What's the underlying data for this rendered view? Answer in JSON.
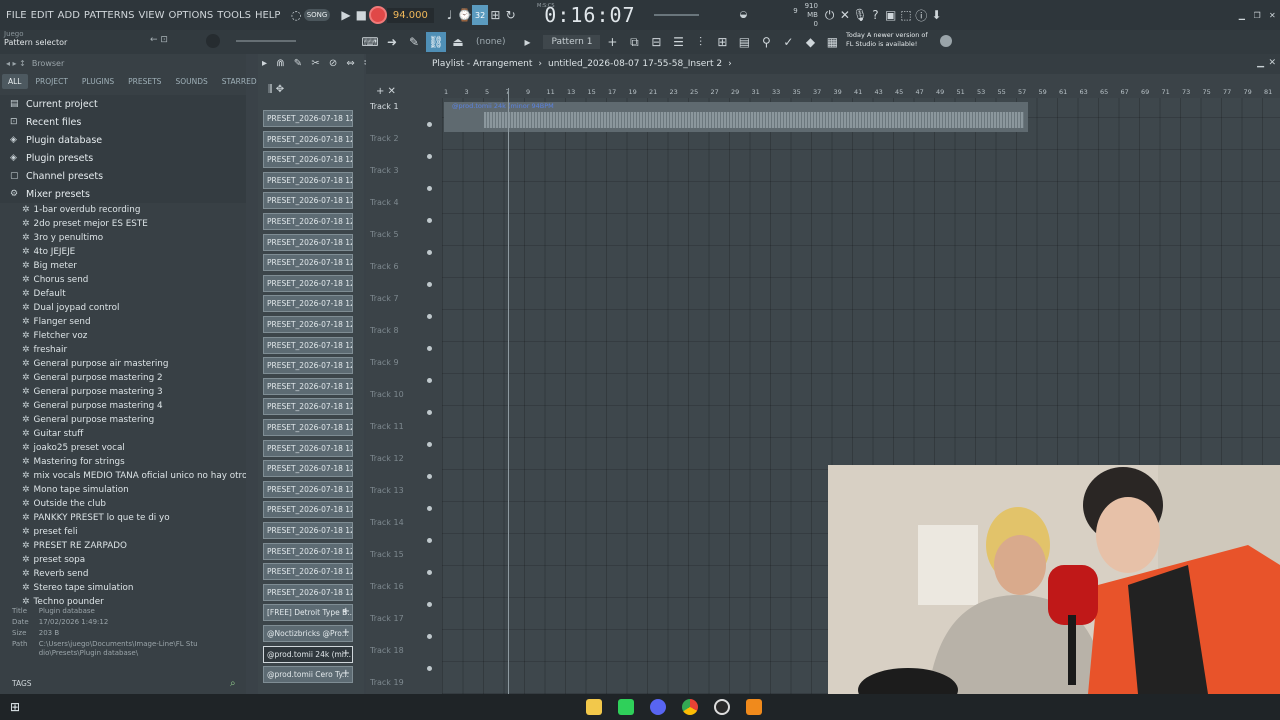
{
  "menu": [
    "FILE",
    "EDIT",
    "ADD",
    "PATTERNS",
    "VIEW",
    "OPTIONS",
    "TOOLS",
    "HELP"
  ],
  "transport": {
    "song_toggle": "SONG",
    "tempo": "94.000",
    "time": "0:16:07",
    "time_mode": "M:S:CS",
    "memory": "910 MB",
    "cpu": "0",
    "bars": "9",
    "beat_snap": "32"
  },
  "toolbar2": {
    "hint_user": "Juego",
    "hint": "Pattern selector",
    "snap": "(none)",
    "pattern": "Pattern 1",
    "news_line1": "Today  A newer version of",
    "news_line2": "FL Studio is available!"
  },
  "browser": {
    "title": "Browser",
    "tabs": [
      "ALL",
      "PROJECT",
      "PLUGINS",
      "PRESETS",
      "SOUNDS",
      "STARRED"
    ],
    "folders": [
      {
        "label": "Current project",
        "icon": "project-icon"
      },
      {
        "label": "Recent files",
        "icon": "recent-icon"
      },
      {
        "label": "Plugin database",
        "icon": "plugin-db-icon"
      },
      {
        "label": "Plugin presets",
        "icon": "plugin-presets-icon"
      },
      {
        "label": "Channel presets",
        "icon": "channel-presets-icon"
      },
      {
        "label": "Mixer presets",
        "icon": "mixer-presets-icon"
      }
    ],
    "presets": [
      "1-bar overdub recording",
      "2do preset mejor ES ESTE",
      "3ro y penultimo",
      "4to JEJEJE",
      "Big meter",
      "Chorus send",
      "Default",
      "Dual joypad control",
      "Flanger send",
      "Fletcher voz",
      "freshair",
      "General purpose air mastering",
      "General purpose mastering 2",
      "General purpose mastering 3",
      "General purpose mastering 4",
      "General purpose mastering",
      "Guitar stuff",
      "joako25 preset vocal",
      "Mastering for strings",
      "mix vocals MEDIO TANA oficial unico no hay otro en el mundo",
      "Mono tape simulation",
      "Outside the club",
      "PANKKY PRESET lo que te di yo",
      "preset feli",
      "PRESET RE ZARPADO",
      "preset sopa",
      "Reverb send",
      "Stereo tape simulation",
      "Techno pounder"
    ],
    "info": {
      "title_k": "Title",
      "title_v": "Plugin database",
      "date_k": "Date",
      "date_v": "17/02/2026 1:49:12",
      "size_k": "Size",
      "size_v": "203 B",
      "path_k": "Path",
      "path_v": "C:\\Users\\juego\\Documents\\Image-Line\\FL Studio\\Presets\\Plugin database\\"
    },
    "tags": "TAGS"
  },
  "samples": [
    "PRESET_2026-07-18 12-...",
    "PRESET_2026-07-18 12-...",
    "PRESET_2026-07-18 12-...",
    "PRESET_2026-07-18 12-...",
    "PRESET_2026-07-18 12-...",
    "PRESET_2026-07-18 12-...",
    "PRESET_2026-07-18 12-...",
    "PRESET_2026-07-18 12-...",
    "PRESET_2026-07-18 12-...",
    "PRESET_2026-07-18 12-...",
    "PRESET_2026-07-18 12-...",
    "PRESET_2026-07-18 12-...",
    "PRESET_2026-07-18 12-...",
    "PRESET_2026-07-18 12-...",
    "PRESET_2026-07-18 12-...",
    "PRESET_2026-07-18 12-...",
    "PRESET_2026-07-18 12-...",
    "PRESET_2026-07-18 12-...",
    "PRESET_2026-07-18 12-...",
    "PRESET_2026-07-18 12-...",
    "PRESET_2026-07-18 12-...",
    "PRESET_2026-07-18 12-...",
    "PRESET_2026-07-18 12-...",
    "PRESET_2026-07-18 12-...",
    "[FREE] Detroit Type B...",
    "@Noctizbricks @Pro...",
    "@prod.tomii 24k (mi...",
    "@prod.tomii Cero Ty..."
  ],
  "playlist": {
    "title": "Playlist - Arrangement",
    "project": "untitled_2026-08-07 17-55-58_Insert 2",
    "clip": "@prod.tomii 24k (minor 94BPM",
    "tracks": [
      "Track 1",
      "Track 2",
      "Track 3",
      "Track 4",
      "Track 5",
      "Track 6",
      "Track 7",
      "Track 8",
      "Track 9",
      "Track 10",
      "Track 11",
      "Track 12",
      "Track 13",
      "Track 14",
      "Track 15",
      "Track 16",
      "Track 17",
      "Track 18",
      "Track 19"
    ],
    "ruler": [
      "1",
      "3",
      "5",
      "7",
      "9",
      "11",
      "13",
      "15",
      "17",
      "19",
      "21",
      "23",
      "25",
      "27",
      "29",
      "31",
      "33",
      "35",
      "37",
      "39",
      "41",
      "43",
      "45",
      "47",
      "49",
      "51",
      "53",
      "55",
      "57",
      "59",
      "61",
      "63",
      "65",
      "67",
      "69",
      "71",
      "73",
      "75",
      "77",
      "79",
      "81"
    ]
  },
  "taskbar": {
    "icons": [
      "windows-start-icon",
      "file-explorer-icon",
      "app-green-icon",
      "discord-icon",
      "chrome-icon",
      "obs-icon",
      "fl-studio-icon"
    ]
  }
}
